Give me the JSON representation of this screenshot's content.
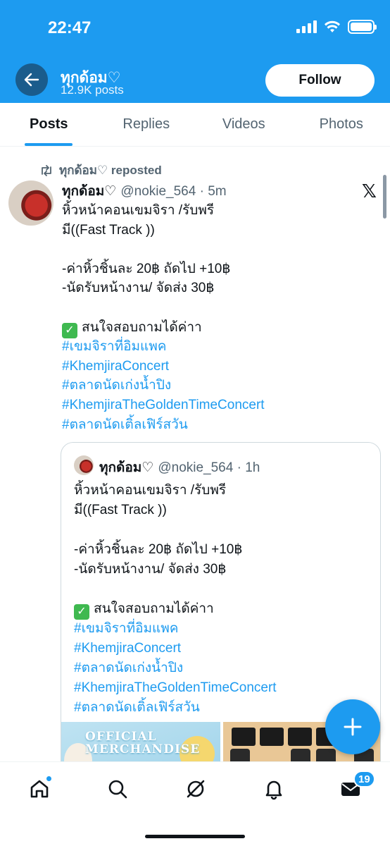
{
  "status_bar": {
    "time": "22:47"
  },
  "header": {
    "name": "ทุกด้อม♡",
    "post_count": "12.9K posts",
    "follow_label": "Follow"
  },
  "tabs": [
    {
      "label": "Posts",
      "active": true
    },
    {
      "label": "Replies",
      "active": false
    },
    {
      "label": "Videos",
      "active": false
    },
    {
      "label": "Photos",
      "active": false
    }
  ],
  "tweet": {
    "repost_label": "ทุกด้อม♡ reposted",
    "author_name": "ทุกด้อม♡",
    "handle_time": "@nokie_564 · 5m",
    "lines": [
      "หิ้วหน้าคอนเขมจิรา /รับพรี",
      "มี((Fast Track ))",
      "",
      "-ค่าหิ้วชิ้นละ  20฿ ถัดไป +10฿",
      "-นัดรับหน้างาน/ จัดส่ง 30฿",
      ""
    ],
    "check_line": "สนใจสอบถามได้ค่าา",
    "hashtags": [
      "#เขมจิราที่อิมแพค",
      "#KhemjiraConcert",
      "#ตลาดนัดเก่งน้ำปิง",
      "#KhemjiraTheGoldenTimeConcert",
      "#ตลาดนัดเติ้ลเฟิร์สวัน"
    ]
  },
  "quoted_tweet": {
    "author_name": "ทุกด้อม♡",
    "handle_time": "@nokie_564 · 1h",
    "lines": [
      "หิ้วหน้าคอนเขมจิรา /รับพรี",
      "มี((Fast Track ))",
      "",
      "-ค่าหิ้วชิ้นละ  20฿ ถัดไป +10฿",
      "-นัดรับหน้างาน/ จัดส่ง 30฿",
      ""
    ],
    "check_line": "สนใจสอบถามได้ค่าา",
    "hashtags": [
      "#เขมจิราที่อิมแพค",
      "#KhemjiraConcert",
      "#ตลาดนัดเก่งน้ำปิง",
      "#KhemjiraTheGoldenTimeConcert",
      "#ตลาดนัดเติ้ลเฟิร์สวัน"
    ],
    "image_1_text": "OFFICIAL MERCHANDISE"
  },
  "bottom_nav": {
    "items": [
      "home-icon",
      "search-icon",
      "grok-icon",
      "notifications-icon",
      "messages-icon"
    ],
    "messages_badge": "19"
  },
  "colors": {
    "accent": "#1d9bf0",
    "text": "#0f1419",
    "muted": "#536471"
  }
}
